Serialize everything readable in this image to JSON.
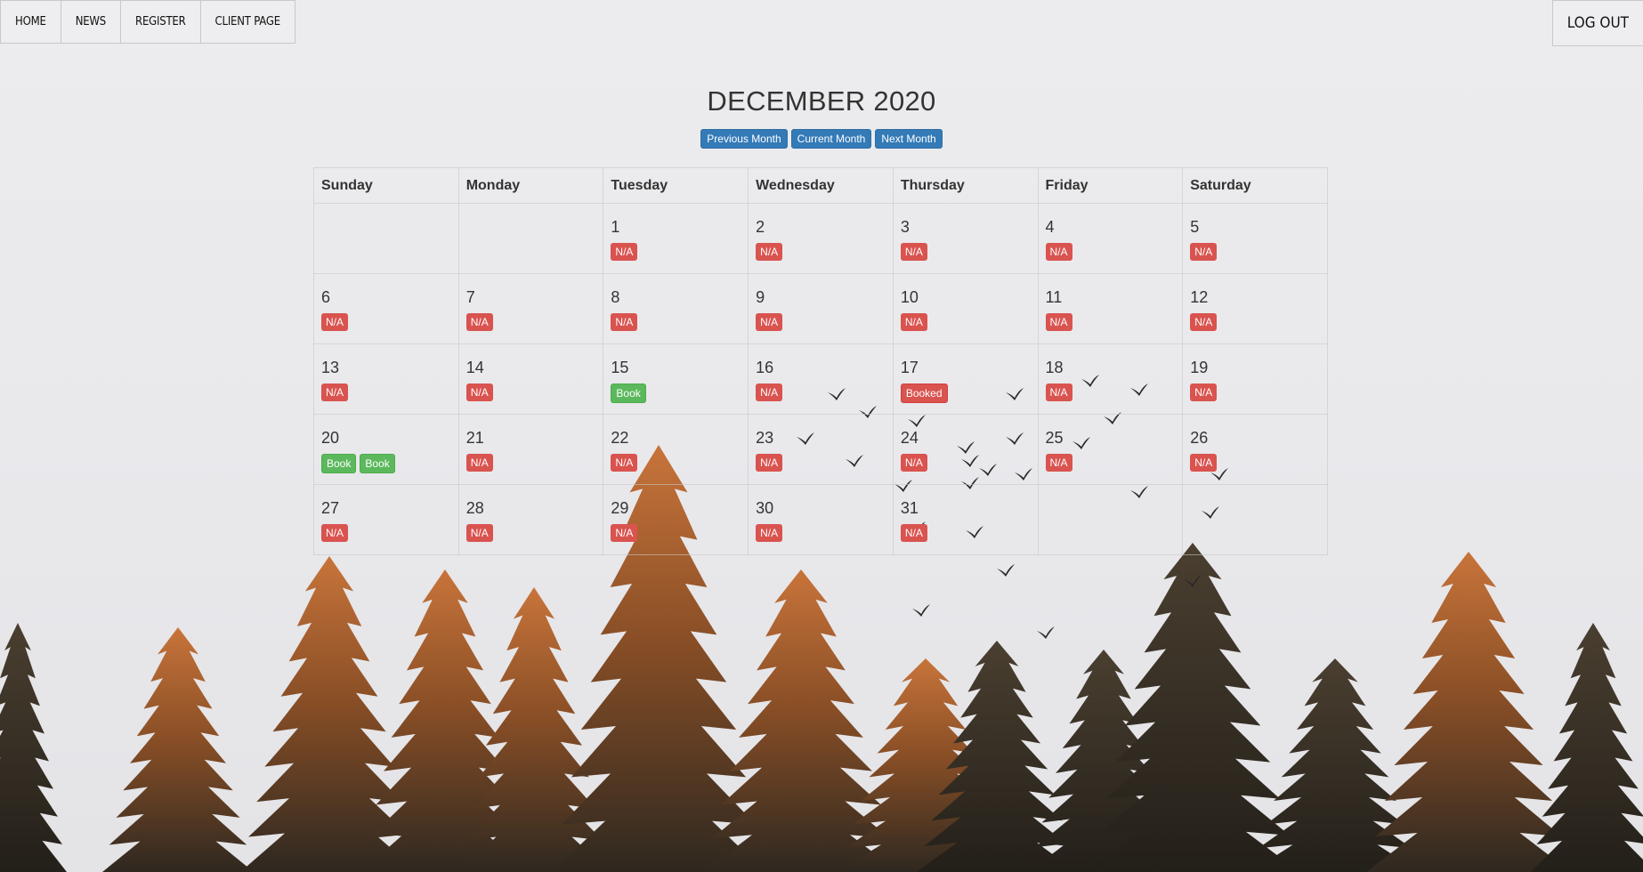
{
  "nav": {
    "items": [
      {
        "label": "HOME"
      },
      {
        "label": "NEWS"
      },
      {
        "label": "REGISTER"
      },
      {
        "label": "CLIENT PAGE"
      }
    ],
    "logout_label": "LOG OUT"
  },
  "calendar": {
    "title": "DECEMBER 2020",
    "buttons": {
      "previous": "Previous Month",
      "current": "Current Month",
      "next": "Next Month"
    },
    "weekdays": [
      "Sunday",
      "Monday",
      "Tuesday",
      "Wednesday",
      "Thursday",
      "Friday",
      "Saturday"
    ],
    "weeks": [
      [
        {
          "day": "",
          "labels": []
        },
        {
          "day": "",
          "labels": []
        },
        {
          "day": "1",
          "labels": [
            "N/A"
          ]
        },
        {
          "day": "2",
          "labels": [
            "N/A"
          ]
        },
        {
          "day": "3",
          "labels": [
            "N/A"
          ]
        },
        {
          "day": "4",
          "labels": [
            "N/A"
          ]
        },
        {
          "day": "5",
          "labels": [
            "N/A"
          ]
        }
      ],
      [
        {
          "day": "6",
          "labels": [
            "N/A"
          ]
        },
        {
          "day": "7",
          "labels": [
            "N/A"
          ]
        },
        {
          "day": "8",
          "labels": [
            "N/A"
          ]
        },
        {
          "day": "9",
          "labels": [
            "N/A"
          ]
        },
        {
          "day": "10",
          "labels": [
            "N/A"
          ]
        },
        {
          "day": "11",
          "labels": [
            "N/A"
          ]
        },
        {
          "day": "12",
          "labels": [
            "N/A"
          ]
        }
      ],
      [
        {
          "day": "13",
          "labels": [
            "N/A"
          ]
        },
        {
          "day": "14",
          "labels": [
            "N/A"
          ]
        },
        {
          "day": "15",
          "labels": [
            "Book"
          ]
        },
        {
          "day": "16",
          "labels": [
            "N/A"
          ]
        },
        {
          "day": "17",
          "labels": [
            "Booked"
          ]
        },
        {
          "day": "18",
          "labels": [
            "N/A"
          ]
        },
        {
          "day": "19",
          "labels": [
            "N/A"
          ]
        }
      ],
      [
        {
          "day": "20",
          "labels": [
            "Book",
            "Book"
          ]
        },
        {
          "day": "21",
          "labels": [
            "N/A"
          ]
        },
        {
          "day": "22",
          "labels": [
            "N/A"
          ]
        },
        {
          "day": "23",
          "labels": [
            "N/A"
          ]
        },
        {
          "day": "24",
          "labels": [
            "N/A"
          ]
        },
        {
          "day": "25",
          "labels": [
            "N/A"
          ]
        },
        {
          "day": "26",
          "labels": [
            "N/A"
          ]
        }
      ],
      [
        {
          "day": "27",
          "labels": [
            "N/A"
          ]
        },
        {
          "day": "28",
          "labels": [
            "N/A"
          ]
        },
        {
          "day": "29",
          "labels": [
            "N/A"
          ]
        },
        {
          "day": "30",
          "labels": [
            "N/A"
          ]
        },
        {
          "day": "31",
          "labels": [
            "N/A"
          ]
        },
        {
          "day": "",
          "labels": []
        },
        {
          "day": "",
          "labels": []
        }
      ]
    ]
  },
  "colors": {
    "primary": "#337ab7",
    "success": "#5cb85c",
    "danger": "#d9534f",
    "tree_orange": "#c46a2e",
    "tree_dark": "#2f2a22"
  }
}
